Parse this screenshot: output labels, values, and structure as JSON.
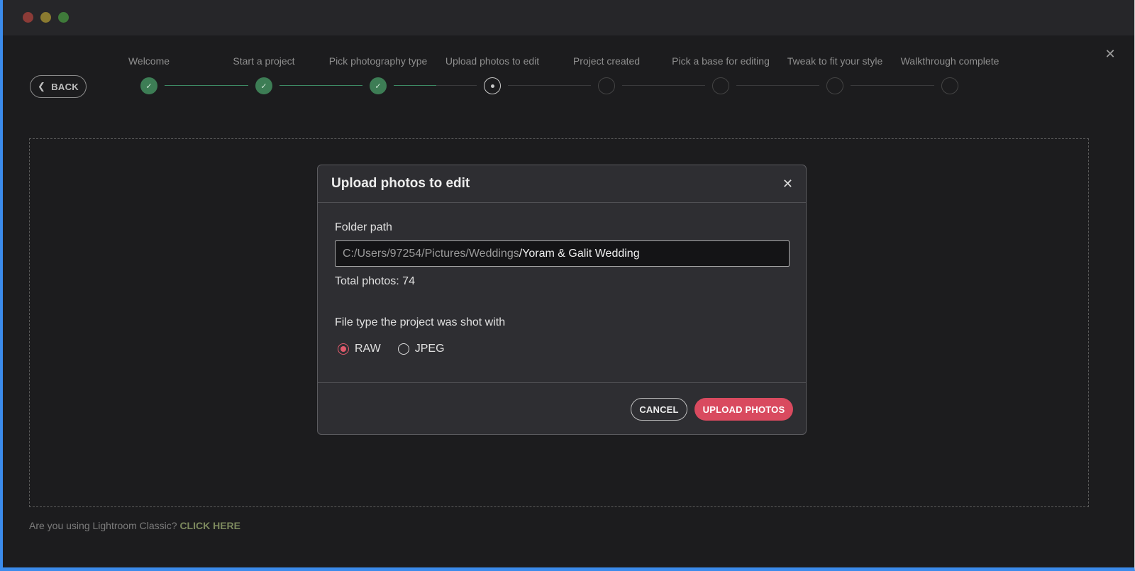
{
  "window": {
    "controls": [
      "close",
      "minimize",
      "maximize"
    ]
  },
  "nav": {
    "back_label": "BACK",
    "back_icon": "chevron-left-icon",
    "close_icon": "close-icon"
  },
  "stepper": {
    "steps": [
      {
        "label": "Welcome",
        "status": "done"
      },
      {
        "label": "Start a project",
        "status": "done"
      },
      {
        "label": "Pick photography type",
        "status": "done"
      },
      {
        "label": "Upload photos to edit",
        "status": "current"
      },
      {
        "label": "Project created",
        "status": "todo"
      },
      {
        "label": "Pick a base for editing",
        "status": "todo"
      },
      {
        "label": "Tweak to fit your style",
        "status": "todo"
      },
      {
        "label": "Walkthrough complete",
        "status": "todo"
      }
    ]
  },
  "footer": {
    "question": "Are you using Lightroom Classic?",
    "link": "CLICK HERE"
  },
  "dialog": {
    "title": "Upload photos to edit",
    "folder_label": "Folder path",
    "folder_prefix": "C:/Users/97254/Pictures/Weddings",
    "folder_suffix": "/Yoram & Galit Wedding",
    "total_photos": "Total photos: 74",
    "filetype_label": "File type the project was shot with",
    "filetype_options": [
      {
        "label": "RAW",
        "selected": true
      },
      {
        "label": "JPEG",
        "selected": false
      }
    ],
    "cancel_label": "CANCEL",
    "upload_label": "UPLOAD PHOTOS"
  },
  "colors": {
    "accent": "#d94a5f",
    "done_step": "#3d7d55",
    "radio_selected": "#e05a6c"
  }
}
